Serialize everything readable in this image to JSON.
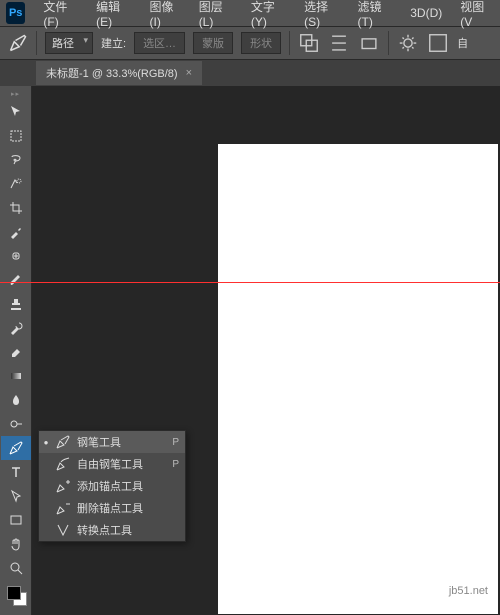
{
  "logo": "Ps",
  "menu": [
    "文件(F)",
    "编辑(E)",
    "图像(I)",
    "图层(L)",
    "文字(Y)",
    "选择(S)",
    "滤镜(T)",
    "3D(D)",
    "视图(V"
  ],
  "opt": {
    "mode_label": "路径",
    "build_label": "建立:",
    "btn_sel": "选区…",
    "btn_mask": "蒙版",
    "btn_shape": "形状"
  },
  "tab": {
    "title": "未标题-1 @ 33.3%(RGB/8)",
    "close": "×"
  },
  "flyout": [
    {
      "label": "钢笔工具",
      "key": "P",
      "sel": true
    },
    {
      "label": "自由钢笔工具",
      "key": "P",
      "sel": false
    },
    {
      "label": "添加锚点工具",
      "key": "",
      "sel": false
    },
    {
      "label": "删除锚点工具",
      "key": "",
      "sel": false
    },
    {
      "label": "转换点工具",
      "key": "",
      "sel": false
    }
  ],
  "watermark": "jb51.net"
}
